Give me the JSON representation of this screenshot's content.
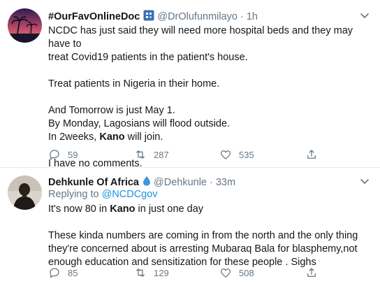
{
  "tweets": [
    {
      "name": "#OurFavOnlineDoc",
      "handle": "@DrOlufunmilayo",
      "dot": "·",
      "time": "1h",
      "lines": [
        "NCDC has just said they will need more hospital beds and they may have to",
        "treat Covid19 patients in the patient's house.",
        "Treat patients in Nigeria in their home.",
        "And Tomorrow is just May 1.",
        "By Monday, Lagosians will flood outside.",
        "In 2weeks,",
        "Kano",
        "will join.",
        "I have no comments."
      ],
      "replies": "59",
      "retweets": "287",
      "likes": "535"
    },
    {
      "name": "Dehkunle Of Africa",
      "handle": "@Dehkunle",
      "dot": "·",
      "time": "33m",
      "replying_prefix": "Replying to",
      "replying_to": "@NCDCgov",
      "line1_pre": "It's now 80 in",
      "line1_bold": "Kano",
      "line1_post": "in just one day",
      "lines": [
        "These kinda numbers are coming in from the north and the only thing",
        "they're concerned about is arresting Mubaraq Bala for blasphemy,not",
        "enough education and sensitization for these people . Sighs"
      ],
      "replies": "85",
      "retweets": "129",
      "likes": "508"
    }
  ],
  "icons": {
    "reply": "reply-icon",
    "retweet": "retweet-icon",
    "like": "heart-icon",
    "share": "share-icon",
    "caret": "chevron-down-icon",
    "badge": "doctor-badge-icon",
    "droplet": "water-drop-icon"
  },
  "colors": {
    "text": "#14171a",
    "secondary": "#657786",
    "link": "#1b95e0",
    "border": "#e6ecf0"
  }
}
